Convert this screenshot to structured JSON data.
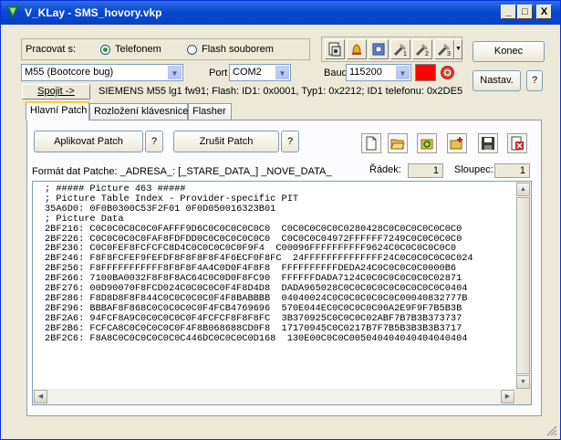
{
  "window": {
    "title": "V_KLay - SMS_hovory.vkp",
    "minimize": "_",
    "maximize": "□",
    "close": "X"
  },
  "connection": {
    "work_with_label": "Pracovat s:",
    "radio_phone": "Telefonem",
    "radio_flash": "Flash souborem",
    "model_value": "M55 (Bootcore bug)",
    "port_label": "Port",
    "port_value": "COM2",
    "baud_label": "Baud",
    "baud_value": "115200",
    "connect_label": "Spojit ->",
    "status_text": "SIEMENS M55 lg1 fw91; Flash: ID1: 0x0001, Typ1: 0x2212; ID1 telefonu: 0x2DE5",
    "status_color": "#ff0000"
  },
  "side_buttons": {
    "end_label": "Konec",
    "settings_label": "Nastav.",
    "help_label": "?"
  },
  "toolbar_icons": [
    "phone-book-icon",
    "bell-icon",
    "chip-icon",
    "tool1-icon",
    "tool2-icon",
    "tool3-icon"
  ],
  "tabs": [
    {
      "label": "Hlavní Patch",
      "active": true
    },
    {
      "label": "Rozložení klávesnice",
      "active": false
    },
    {
      "label": "Flasher",
      "active": false
    }
  ],
  "patch": {
    "apply_label": "Aplikovat Patch",
    "apply_help": "?",
    "cancel_label": "Zrušit Patch",
    "cancel_help": "?",
    "format_label": "Formát dat Patche: _ADRESA_: [_STARE_DATA_] _NOVE_DATA_",
    "row_label": "Řádek:",
    "row_value": "1",
    "col_label": "Sloupec:",
    "col_value": "1"
  },
  "editor_lines": [
    "; ##### Picture 463 #####",
    "; Picture Table Index - Provider-specific PIT",
    "35A6D0: 0F0B0300C53F2F01 0F0D050016323B01",
    "; Picture Data",
    "2BF216: C0C0C0C0C0C0FAFFF9D6C0C0C0C0C0C0  C0C0C0C0C0C0280428C0C0C0C0C0C0C0",
    "2BF226: C0C0C0C0C0FAF8FDFDD0C0C0C0C0C0C0  C0C0C0C04972FFFFFF7249C0C0C0C0C0",
    "2BF236: C0C0FEF8FCFCFC8D4C0C0C0C0C0F9F4  C00096FFFFFFFFFF9624C0C0C0C0C0C0",
    "2BF246: F8F8FCFEF9FEFDF8F8F8F8F4F6ECF0F8FC  24FFFFFFFFFFFFFF24C0C0C0C0C0C024",
    "2BF256: F8FFFFFFFFFFF8F8F8F4A4C0D0F4F8F8  FFFFFFFFFFDEDA24C0C0C0C0C0000B6",
    "2BF266: 7100BA0032F8F8F8AC64C0C0D0F8FC90  FFFFFFDADA7124C0C0C0C0C0C0C02871",
    "2BF276: 00D90070F8FCD024C0C0C0C0F4F8D4D8  DADA965028C0C0C0C0C0C0C0C0C0C0404",
    "2BF286: F8D8D8F8F844C0C0C0C0C0F4F8BABBBB  04040024C0C0C0C0C0C0C00040832777B",
    "2BF296: BBBAF8F868C0C0C0C0C0F4FCB4769696  570E044EC0C0C0C0C06A2E9F9F7B5B3B",
    "2BF2A6: 94FCF8A9C0C0C0C0C0F4FCFCF8F8F8FC  3B370925C0C0C0C02ABF7B7B3B373737",
    "2BF2B6: FCFCA8C0C0C0C0C0F4F8B068688CD0F8  17170945C0C0217B7F7B5B3B3B3B3717",
    "2BF2C6: F8A8C0C0C0C0C0C0C446DC0C0C0C0D168  130E00C0C0C005040404040404040404"
  ]
}
